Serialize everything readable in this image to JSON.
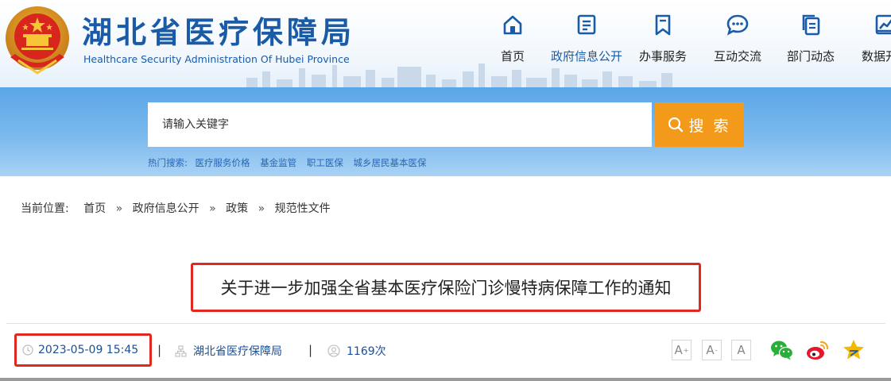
{
  "header": {
    "title": "湖北省医疗保障局",
    "subtitle": "Healthcare Security Administration Of Hubei Province",
    "nav": [
      {
        "label": "首页",
        "icon": "home-icon",
        "active": false
      },
      {
        "label": "政府信息公开",
        "icon": "document-icon",
        "active": true
      },
      {
        "label": "办事服务",
        "icon": "bookmark-icon",
        "active": false
      },
      {
        "label": "互动交流",
        "icon": "chat-icon",
        "active": false
      },
      {
        "label": "部门动态",
        "icon": "copy-icon",
        "active": false
      },
      {
        "label": "数据开放",
        "icon": "chart-icon",
        "active": false
      }
    ]
  },
  "search": {
    "placeholder": "请输入关键字",
    "button_label": "搜 索",
    "hot_label": "热门搜索:",
    "hot_terms": [
      "医疗服务价格",
      "基金监管",
      "职工医保",
      "城乡居民基本医保"
    ]
  },
  "breadcrumb": {
    "label": "当前位置:",
    "items": [
      "首页",
      "政府信息公开",
      "政策",
      "规范性文件"
    ],
    "separator": "»"
  },
  "article": {
    "title": "关于进一步加强全省基本医疗保险门诊慢特病保障工作的通知",
    "date": "2023-05-09 15:45",
    "source": "湖北省医疗保障局",
    "views": "1169次",
    "meta_divider": "|"
  },
  "font_size": {
    "large": "A",
    "medium": "A",
    "small": "A"
  },
  "colors": {
    "brand_blue": "#1a5ba8",
    "search_orange": "#f39a1a",
    "highlight_red": "#e0281f",
    "banner_blue": "#6eb2ec",
    "wechat_green": "#2aae3a",
    "weibo_red": "#e6162d",
    "favorite_gold": "#f5b800"
  },
  "icons": {
    "emblem": "national-emblem-icon",
    "search": "search-icon",
    "clock": "clock-icon",
    "source": "org-chart-icon",
    "views": "user-icon",
    "wechat": "wechat-icon",
    "weibo": "weibo-icon",
    "favorite": "star-icon"
  }
}
